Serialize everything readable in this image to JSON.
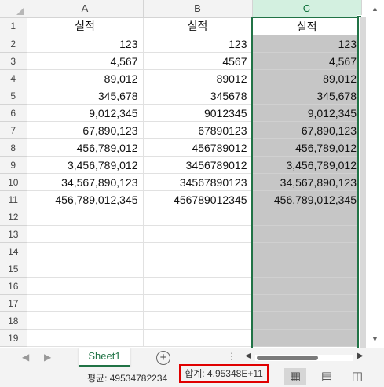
{
  "sheet": {
    "columns": [
      "A",
      "B",
      "C"
    ],
    "selected_column": "C",
    "rows": [
      {
        "n": "1",
        "a": "실적",
        "b": "실적",
        "c": "실적"
      },
      {
        "n": "2",
        "a": "123",
        "b": "123",
        "c": "123"
      },
      {
        "n": "3",
        "a": "4,567",
        "b": "4567",
        "c": "4,567"
      },
      {
        "n": "4",
        "a": "89,012",
        "b": "89012",
        "c": "89,012"
      },
      {
        "n": "5",
        "a": "345,678",
        "b": "345678",
        "c": "345,678"
      },
      {
        "n": "6",
        "a": "9,012,345",
        "b": "9012345",
        "c": "9,012,345"
      },
      {
        "n": "7",
        "a": "67,890,123",
        "b": "67890123",
        "c": "67,890,123"
      },
      {
        "n": "8",
        "a": "456,789,012",
        "b": "456789012",
        "c": "456,789,012"
      },
      {
        "n": "9",
        "a": "3,456,789,012",
        "b": "3456789012",
        "c": "3,456,789,012"
      },
      {
        "n": "10",
        "a": "34,567,890,123",
        "b": "34567890123",
        "c": "34,567,890,123"
      },
      {
        "n": "11",
        "a": "456,789,012,345",
        "b": "456789012345",
        "c": "456,789,012,345"
      },
      {
        "n": "12",
        "a": "",
        "b": "",
        "c": ""
      },
      {
        "n": "13",
        "a": "",
        "b": "",
        "c": ""
      },
      {
        "n": "14",
        "a": "",
        "b": "",
        "c": ""
      },
      {
        "n": "15",
        "a": "",
        "b": "",
        "c": ""
      },
      {
        "n": "16",
        "a": "",
        "b": "",
        "c": ""
      },
      {
        "n": "17",
        "a": "",
        "b": "",
        "c": ""
      },
      {
        "n": "18",
        "a": "",
        "b": "",
        "c": ""
      },
      {
        "n": "19",
        "a": "",
        "b": "",
        "c": ""
      }
    ]
  },
  "tabs": {
    "sheet_name": "Sheet1",
    "add_icon": "plus-circle-icon",
    "more_icon": "vertical-dots-icon"
  },
  "status": {
    "average": "평균: 49534782234",
    "sum": "합계: 4.95348E+11",
    "views": [
      "normal-view-icon",
      "page-layout-icon",
      "page-break-preview-icon"
    ]
  },
  "colors": {
    "accent": "#217346",
    "selection_fill": "#c6c6c6",
    "highlight_border": "#e00000"
  }
}
